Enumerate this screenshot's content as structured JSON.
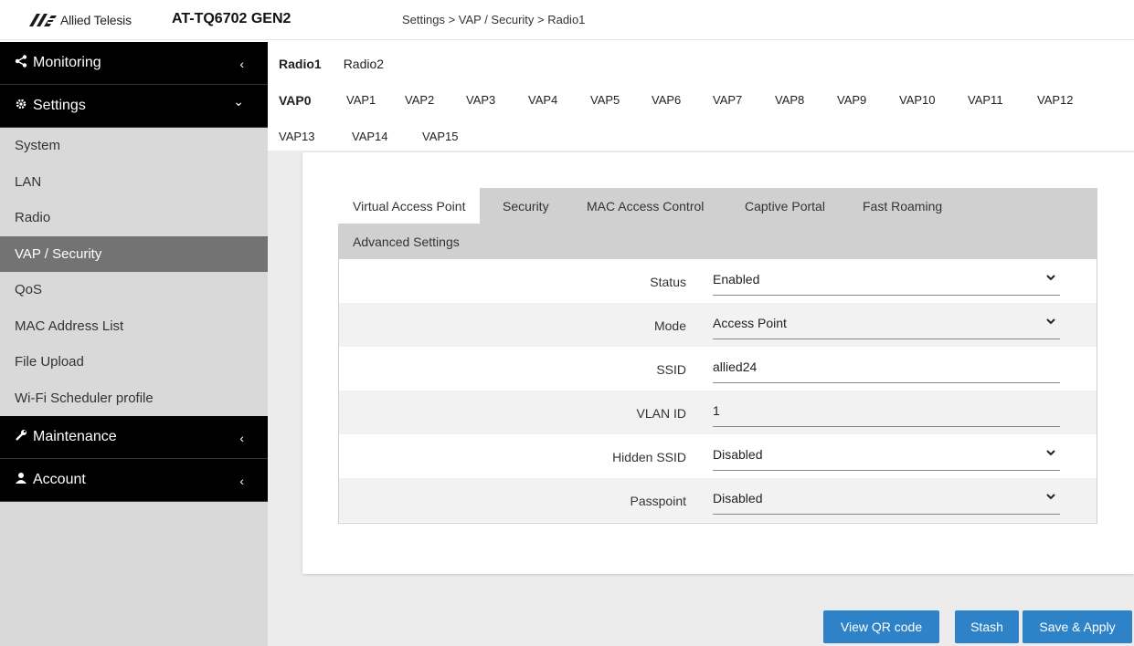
{
  "header": {
    "logo_text": "Allied Telesis",
    "product": "AT-TQ6702 GEN2",
    "breadcrumb": "Settings > VAP / Security > Radio1"
  },
  "sidebar": {
    "sections": [
      {
        "label": "Monitoring",
        "icon": "share-icon",
        "chevron": "‹"
      },
      {
        "label": "Settings",
        "icon": "gear-icon",
        "chevron": "⌄"
      },
      {
        "label": "Maintenance",
        "icon": "wrench-icon",
        "chevron": "‹"
      },
      {
        "label": "Account",
        "icon": "user-icon",
        "chevron": "‹"
      }
    ],
    "items": [
      {
        "label": "System"
      },
      {
        "label": "LAN"
      },
      {
        "label": "Radio"
      },
      {
        "label": "VAP / Security"
      },
      {
        "label": "QoS"
      },
      {
        "label": "MAC Address List"
      },
      {
        "label": "File Upload"
      },
      {
        "label": "Wi-Fi Scheduler profile"
      }
    ],
    "active_item": "VAP / Security"
  },
  "radio_tabs": [
    "Radio1",
    "Radio2"
  ],
  "active_radio": "Radio1",
  "vap_tabs": [
    "VAP0",
    "VAP1",
    "VAP2",
    "VAP3",
    "VAP4",
    "VAP5",
    "VAP6",
    "VAP7",
    "VAP8",
    "VAP9",
    "VAP10",
    "VAP11",
    "VAP12",
    "VAP13",
    "VAP14",
    "VAP15"
  ],
  "active_vap": "VAP0",
  "sub_tabs": [
    "Virtual Access Point",
    "Security",
    "MAC Access Control",
    "Captive Portal",
    "Fast Roaming",
    "Advanced Settings"
  ],
  "active_sub_tab": "Virtual Access Point",
  "form": {
    "rows": [
      {
        "label": "Status",
        "value": "Enabled",
        "type": "select"
      },
      {
        "label": "Mode",
        "value": "Access Point",
        "type": "select"
      },
      {
        "label": "SSID",
        "value": "allied24",
        "type": "text"
      },
      {
        "label": "VLAN ID",
        "value": "1",
        "type": "text"
      },
      {
        "label": "Hidden SSID",
        "value": "Disabled",
        "type": "select"
      },
      {
        "label": "Passpoint",
        "value": "Disabled",
        "type": "select"
      }
    ]
  },
  "buttons": {
    "qr": "View QR code",
    "stash": "Stash",
    "save": "Save & Apply"
  },
  "colors": {
    "accent": "#2e82c8",
    "sidebar_active": "#737373",
    "sidebar_section": "#000000"
  }
}
